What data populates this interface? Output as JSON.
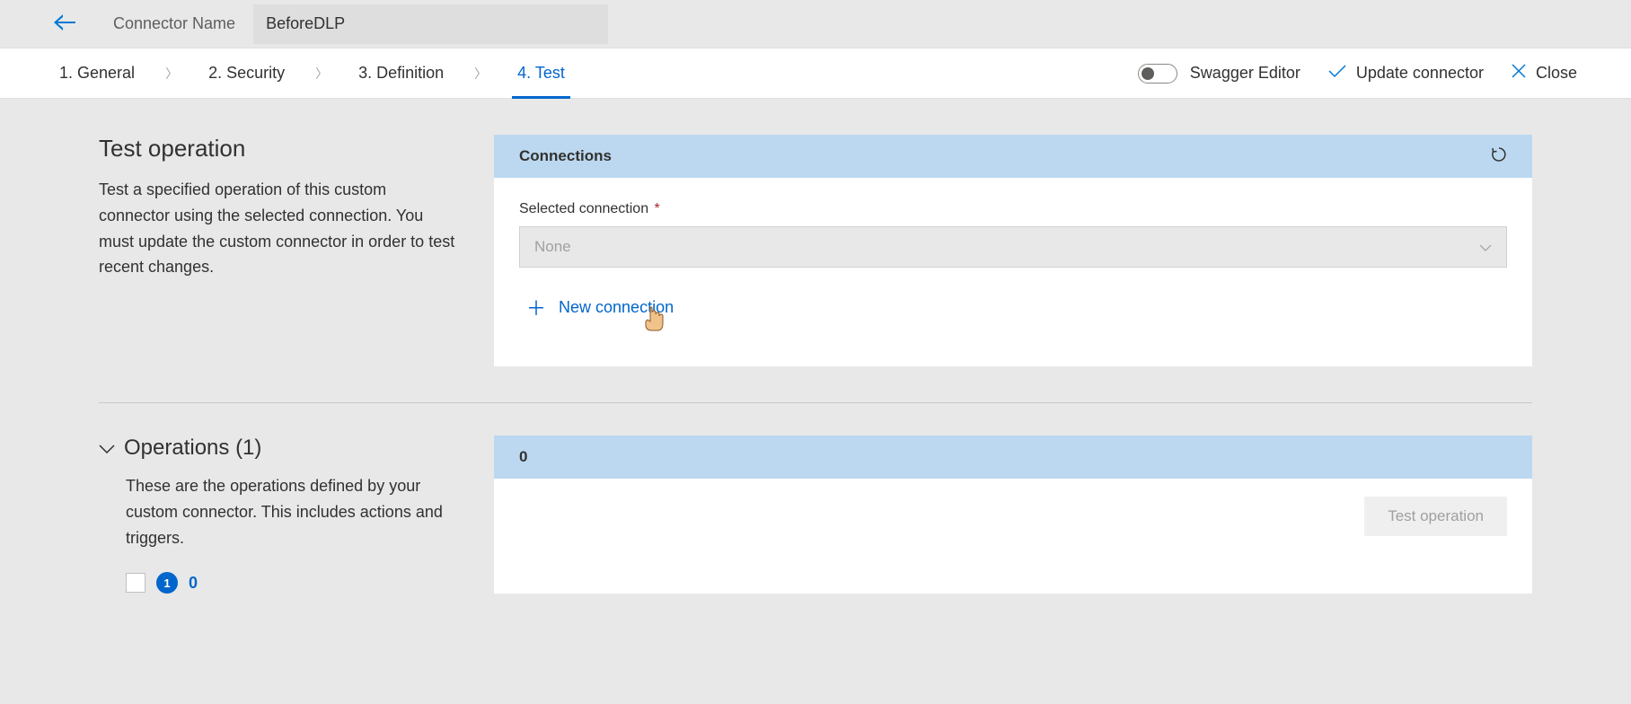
{
  "header": {
    "connector_name_label": "Connector Name",
    "connector_name_value": "BeforeDLP"
  },
  "tabs": {
    "general": "1. General",
    "security": "2. Security",
    "definition": "3. Definition",
    "test": "4. Test"
  },
  "actions": {
    "swagger_label": "Swagger Editor",
    "update_label": "Update connector",
    "close_label": "Close"
  },
  "test_section": {
    "title": "Test operation",
    "desc": "Test a specified operation of this custom connector using the selected connection. You must update the custom connector in order to test recent changes."
  },
  "connections_panel": {
    "header": "Connections",
    "selected_label": "Selected connection",
    "dropdown_placeholder": "None",
    "new_connection": "New connection"
  },
  "operations_section": {
    "title": "Operations (1)",
    "desc": "These are the operations defined by your custom connector. This includes actions and triggers.",
    "badge": "1",
    "count_after": "0"
  },
  "op_panel": {
    "header": "0",
    "test_button": "Test operation"
  }
}
